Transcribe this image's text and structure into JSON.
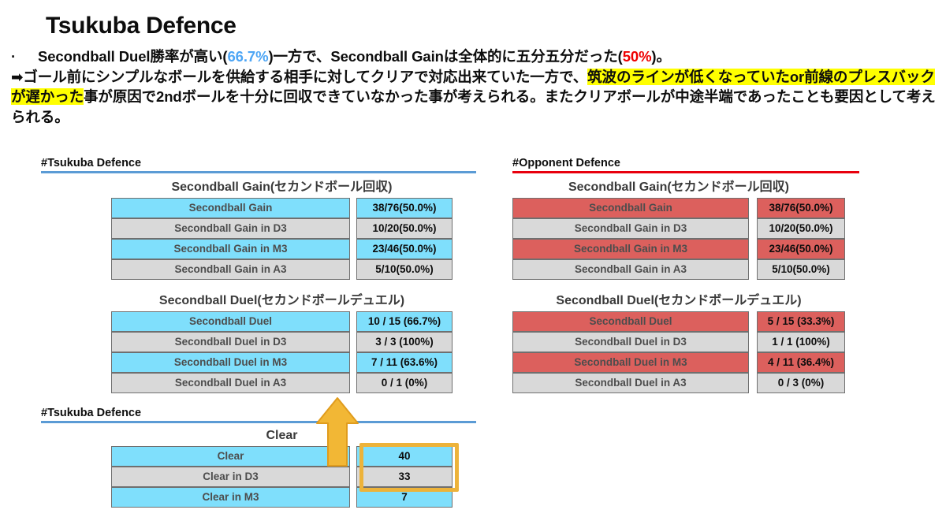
{
  "slide": {
    "title": "Tsukuba Defence"
  },
  "body": {
    "line1_pre": "Secondball Duel勝率が高い(",
    "line1_blue": "66.7%",
    "line1_mid": ")一方で、Secondball Gainは全体的に五分五分だった(",
    "line1_red": "50%",
    "line1_post": ")。",
    "line2_pre": "➡ゴール前にシンプルなボールを供給する相手に対してクリアで対応出来ていた一方で、",
    "line2_hl": "筑波のラインが低くなっていたor前線のプレスバックが遅かった",
    "line2_post": "事が原因で2ndボールを十分に回収できていなかった事が考えられる。またクリアボールが中途半端であったことも要因として考えられる。"
  },
  "sections": {
    "tsukuba_top": "#Tsukuba Defence",
    "opponent": "#Opponent Defence",
    "tsukuba_bottom": "#Tsukuba Defence"
  },
  "tables": {
    "tsukuba_gain": {
      "title": "Secondball Gain(セカンドボール回収)",
      "rows": [
        {
          "label": "Secondball Gain",
          "value": "38/76(50.0%)",
          "style": "cy"
        },
        {
          "label": "Secondball Gain in D3",
          "value": "10/20(50.0%)",
          "style": "gy"
        },
        {
          "label": "Secondball Gain in M3",
          "value": "23/46(50.0%)",
          "style": "cy"
        },
        {
          "label": "Secondball Gain in A3",
          "value": "5/10(50.0%)",
          "style": "gy"
        }
      ]
    },
    "tsukuba_duel": {
      "title": "Secondball Duel(セカンドボールデュエル)",
      "rows": [
        {
          "label": "Secondball Duel",
          "value": "10 / 15 (66.7%)",
          "style": "cy"
        },
        {
          "label": "Secondball Duel in D3",
          "value": "3 / 3 (100%)",
          "style": "gy"
        },
        {
          "label": "Secondball Duel in M3",
          "value": "7 / 11 (63.6%)",
          "style": "cy"
        },
        {
          "label": "Secondball Duel in A3",
          "value": "0 / 1 (0%)",
          "style": "gy"
        }
      ]
    },
    "opponent_gain": {
      "title": "Secondball Gain(セカンドボール回収)",
      "rows": [
        {
          "label": "Secondball Gain",
          "value": "38/76(50.0%)",
          "style": "rd"
        },
        {
          "label": "Secondball Gain in D3",
          "value": "10/20(50.0%)",
          "style": "gy"
        },
        {
          "label": "Secondball Gain in M3",
          "value": "23/46(50.0%)",
          "style": "rd"
        },
        {
          "label": "Secondball Gain in A3",
          "value": "5/10(50.0%)",
          "style": "gy"
        }
      ]
    },
    "opponent_duel": {
      "title": "Secondball Duel(セカンドボールデュエル)",
      "rows": [
        {
          "label": "Secondball Duel",
          "value": "5 / 15 (33.3%)",
          "style": "rd"
        },
        {
          "label": "Secondball Duel in D3",
          "value": "1 / 1 (100%)",
          "style": "gy"
        },
        {
          "label": "Secondball Duel in M3",
          "value": "4 / 11 (36.4%)",
          "style": "rd"
        },
        {
          "label": "Secondball Duel in A3",
          "value": "0 / 3 (0%)",
          "style": "gy"
        }
      ]
    },
    "clear": {
      "title": "Clear",
      "rows": [
        {
          "label": "Clear",
          "value": "40",
          "style": "cy"
        },
        {
          "label": "Clear in D3",
          "value": "33",
          "style": "gy"
        },
        {
          "label": "Clear in M3",
          "value": "7",
          "style": "cy"
        }
      ]
    }
  },
  "annotations": {
    "arrow": "up-arrow",
    "arrow_color": "#edb33a",
    "highlight_box_color": "#edb33a"
  },
  "colors": {
    "cyan": "#7fdffc",
    "grey": "#d9d9d9",
    "red": "#dc605d",
    "rule_blue": "#5b9bd5",
    "rule_red": "#e8000d",
    "text_blue": "#4ea6f5",
    "text_red": "#ee0000",
    "highlight_yellow": "#ffff00"
  }
}
